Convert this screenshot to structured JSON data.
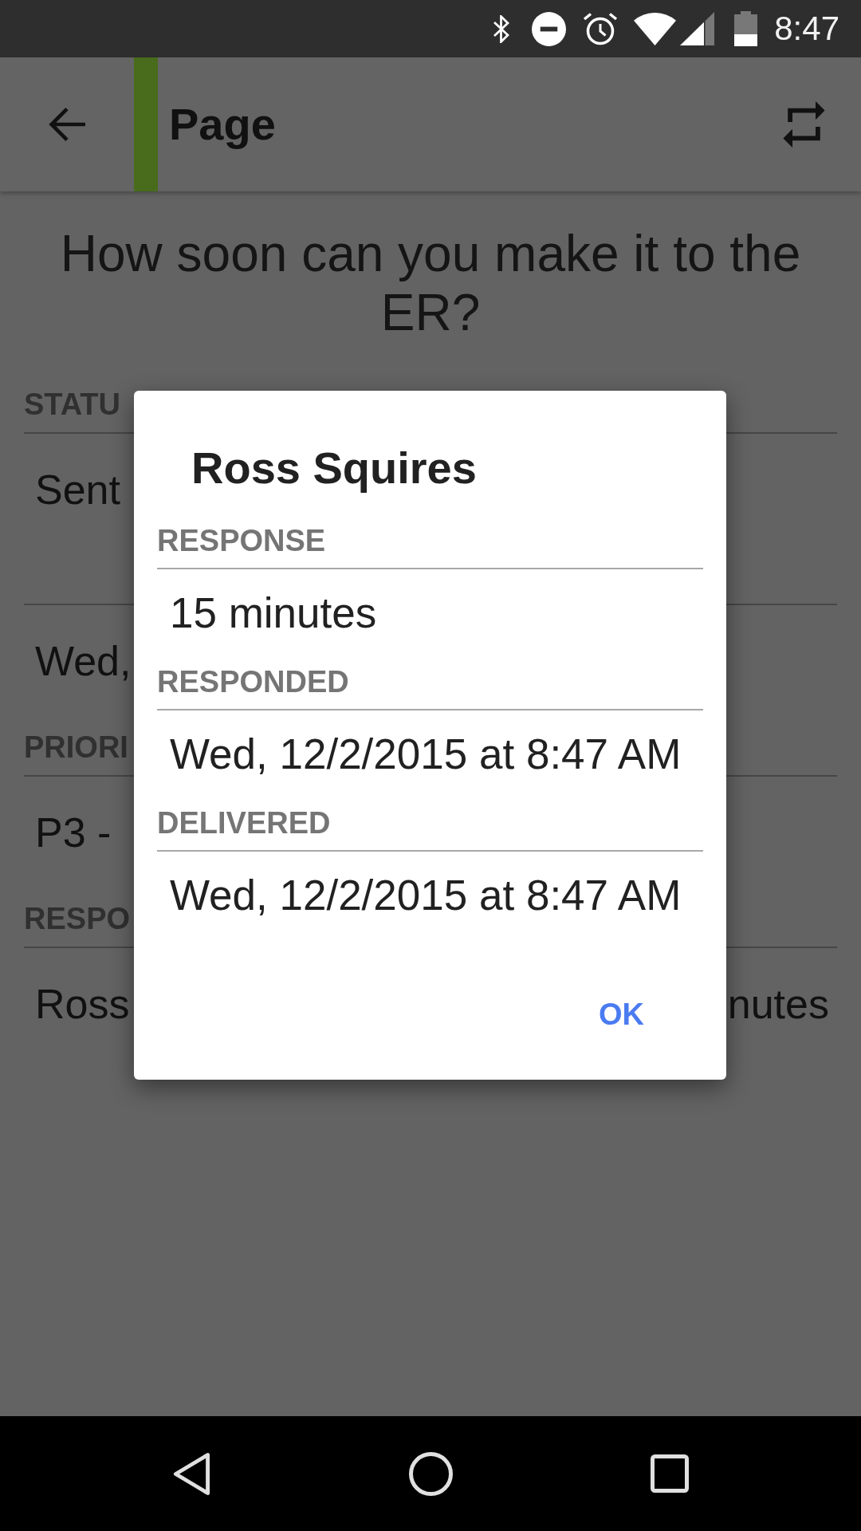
{
  "status_bar": {
    "time": "8:47"
  },
  "app_bar": {
    "title": "Page"
  },
  "question": "How soon can you make it to the ER?",
  "details": [
    {
      "header": "STATU",
      "rows": [
        {
          "text": "Sent"
        }
      ]
    },
    {
      "rows": [
        {
          "text": "Wed,"
        }
      ]
    },
    {
      "header": "PRIORI",
      "rows": [
        {
          "text": "P3 -"
        }
      ]
    },
    {
      "header": "RESPO",
      "rows": [
        {
          "text": "Ross",
          "trailing": "nutes"
        }
      ]
    }
  ],
  "dialog": {
    "title": "Ross Squires",
    "fields": [
      {
        "label": "RESPONSE",
        "value": "15 minutes"
      },
      {
        "label": "RESPONDED",
        "value": "Wed, 12/2/2015 at 8:47 AM"
      },
      {
        "label": "DELIVERED",
        "value": "Wed, 12/2/2015 at 8:47 AM"
      }
    ],
    "buttons": [
      "OK"
    ]
  }
}
